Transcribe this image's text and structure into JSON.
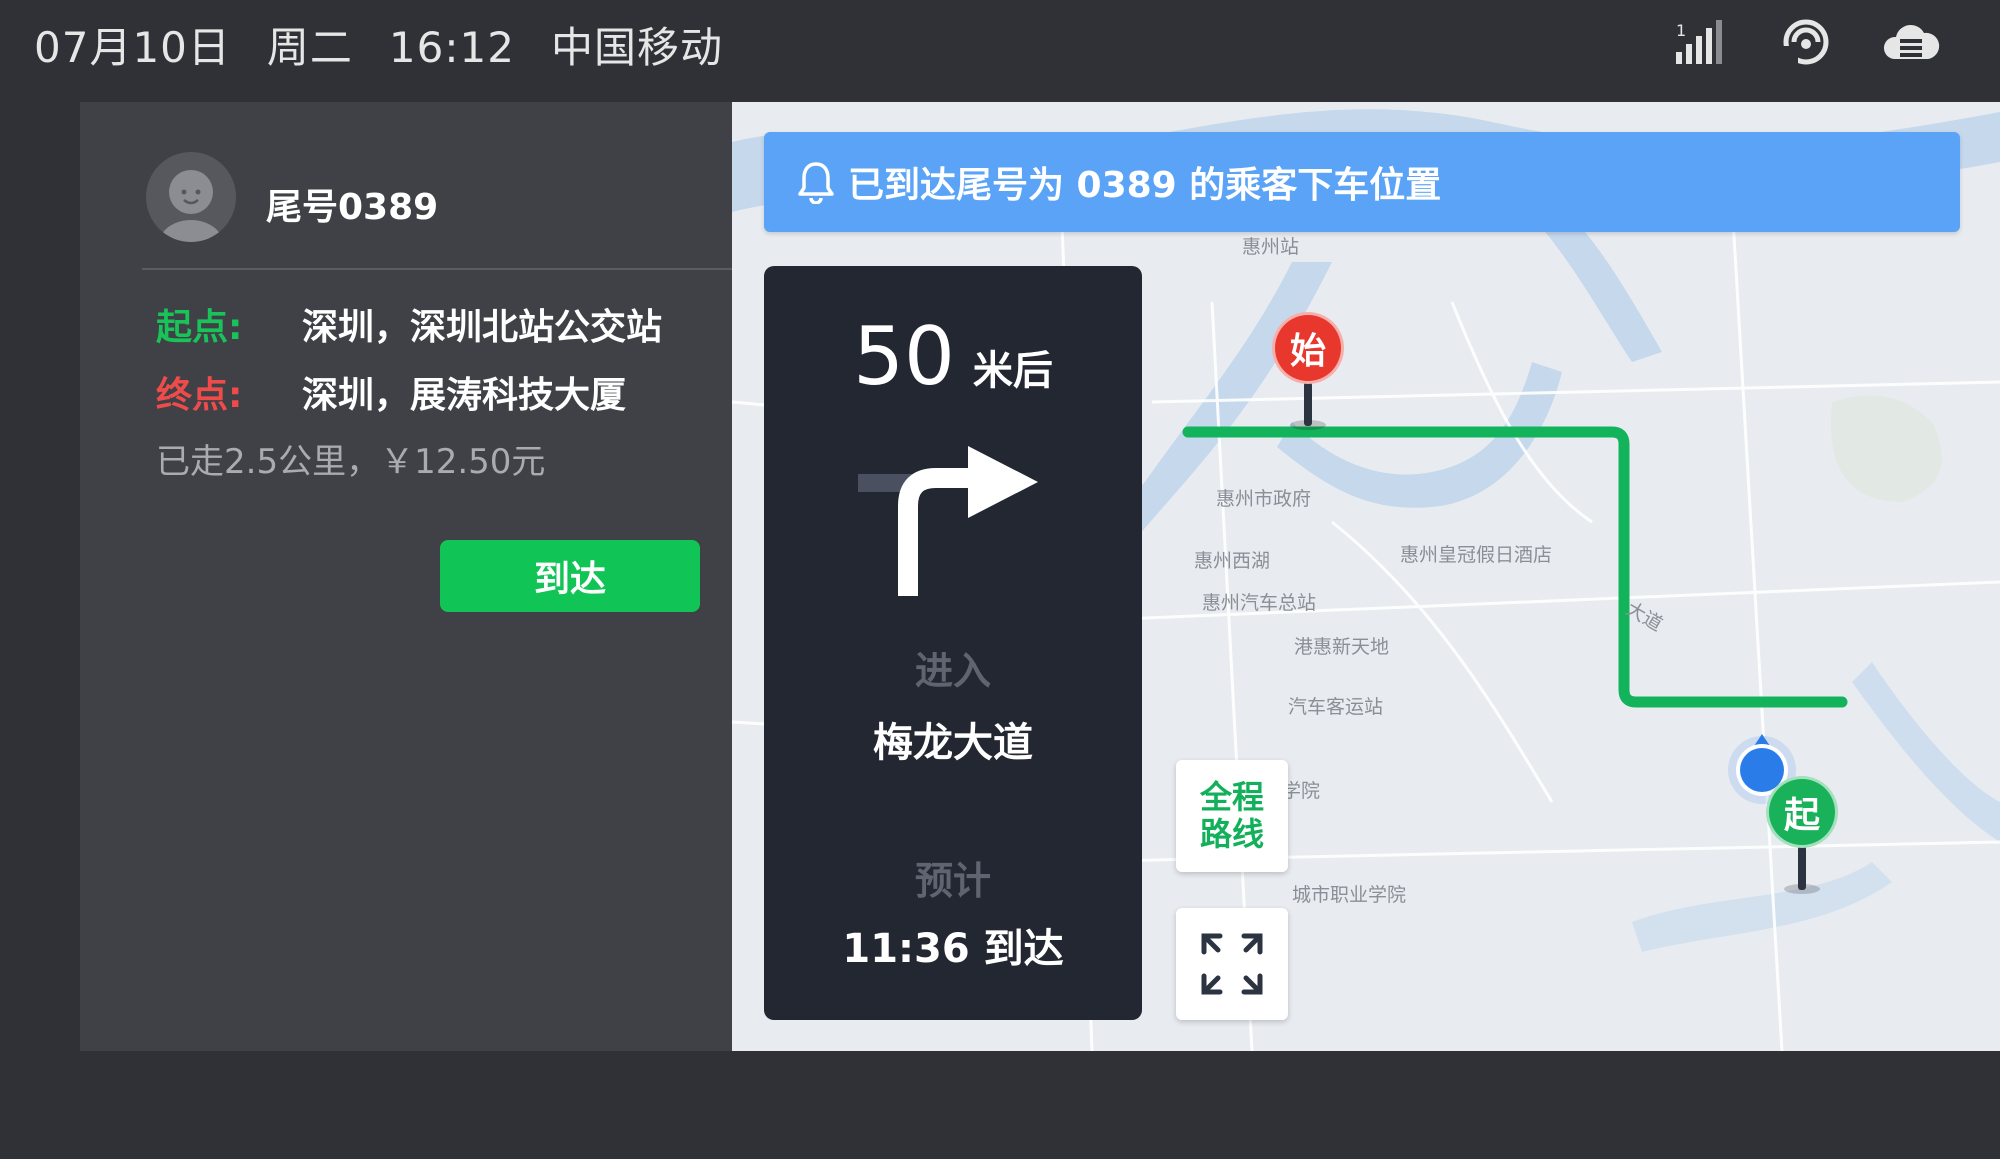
{
  "status_bar": {
    "date": "07月10日",
    "weekday": "周二",
    "time": "16:12",
    "carrier": "中国移动",
    "icons": [
      "signal-icon",
      "wifi-icon",
      "cloud-icon"
    ]
  },
  "passenger": {
    "name": "尾号0389",
    "start_label": "起点:",
    "start_value": "深圳，深圳北站公交站",
    "end_label": "终点:",
    "end_value": "深圳，展涛科技大厦",
    "trip_info": "已走2.5公里，￥12.50元",
    "arrive_button": "到达"
  },
  "notice": {
    "text": "已到达尾号为 0389 的乘客下车位置"
  },
  "navigation": {
    "distance_value": "50",
    "distance_unit": "米后",
    "enter_label": "进入",
    "road_name": "梅龙大道",
    "eta_label": "预计",
    "eta_value": "11:36 到达"
  },
  "map": {
    "full_route_line1": "全程",
    "full_route_line2": "路线",
    "labels": {
      "station": "惠州站",
      "gov": "惠州市政府",
      "west_lake": "惠州西湖",
      "hotel": "惠州皇冠假日酒店",
      "bus_station": "惠州汽车总站",
      "xintiandi": "港惠新天地",
      "passenger_station": "汽车客运站",
      "college": "惠州学院",
      "vocational": "城市职业学院",
      "road": "大道"
    },
    "pin_start_origin": "始",
    "pin_start": "起"
  },
  "colors": {
    "route": "#13b35b",
    "notice": "#5aa3f6",
    "arrive_button": "#10c456",
    "start_label": "#19c35a",
    "end_label": "#ef4b4b",
    "pin_origin": "#e8372c",
    "pin_start": "#19b15a"
  }
}
